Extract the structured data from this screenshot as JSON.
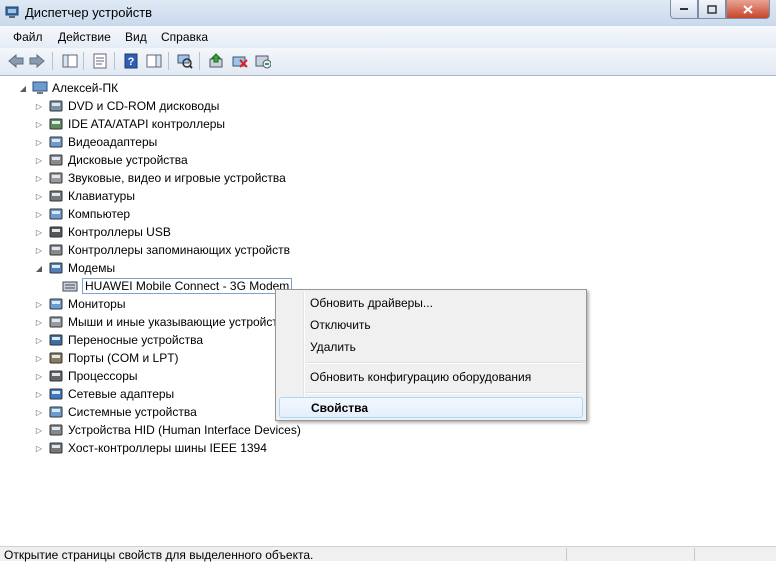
{
  "window": {
    "title": "Диспетчер устройств",
    "controls": [
      "minimize",
      "maximize",
      "close"
    ]
  },
  "menubar": {
    "items": [
      "Файл",
      "Действие",
      "Вид",
      "Справка"
    ]
  },
  "toolbar": {
    "icons": [
      "back-arrow-icon",
      "forward-arrow-icon",
      "show-hide-tree-icon",
      "properties-icon",
      "help-icon",
      "action-pane-icon",
      "scan-hardware-icon",
      "update-driver-icon",
      "disable-device-icon",
      "uninstall-device-icon"
    ]
  },
  "tree": {
    "root": "Алексей-ПК",
    "categories": [
      {
        "label": "DVD и CD-ROM дисководы",
        "expanded": false,
        "icon": "dvd-drive-icon"
      },
      {
        "label": "IDE ATA/ATAPI контроллеры",
        "expanded": false,
        "icon": "ide-controller-icon"
      },
      {
        "label": "Видеоадаптеры",
        "expanded": false,
        "icon": "display-adapter-icon"
      },
      {
        "label": "Дисковые устройства",
        "expanded": false,
        "icon": "disk-drive-icon"
      },
      {
        "label": "Звуковые, видео и игровые устройства",
        "expanded": false,
        "icon": "sound-device-icon"
      },
      {
        "label": "Клавиатуры",
        "expanded": false,
        "icon": "keyboard-icon"
      },
      {
        "label": "Компьютер",
        "expanded": false,
        "icon": "computer-icon"
      },
      {
        "label": "Контроллеры USB",
        "expanded": false,
        "icon": "usb-icon"
      },
      {
        "label": "Контроллеры запоминающих устройств",
        "expanded": false,
        "icon": "storage-controller-icon"
      },
      {
        "label": "Модемы",
        "expanded": true,
        "icon": "modem-icon"
      },
      {
        "label": "Мониторы",
        "expanded": false,
        "icon": "monitor-icon"
      },
      {
        "label": "Мыши и иные указывающие устройства",
        "expanded": false,
        "icon": "mouse-icon"
      },
      {
        "label": "Переносные устройства",
        "expanded": false,
        "icon": "portable-device-icon"
      },
      {
        "label": "Порты (COM и LPT)",
        "expanded": false,
        "icon": "port-icon"
      },
      {
        "label": "Процессоры",
        "expanded": false,
        "icon": "processor-icon"
      },
      {
        "label": "Сетевые адаптеры",
        "expanded": false,
        "icon": "network-adapter-icon"
      },
      {
        "label": "Системные устройства",
        "expanded": false,
        "icon": "system-device-icon"
      },
      {
        "label": "Устройства HID (Human Interface Devices)",
        "expanded": false,
        "icon": "hid-icon"
      },
      {
        "label": "Хост-контроллеры шины IEEE 1394",
        "expanded": false,
        "icon": "ieee1394-icon"
      }
    ],
    "modem_child": "HUAWEI Mobile Connect - 3G Modem"
  },
  "context_menu": {
    "items": [
      {
        "label": "Обновить драйверы..."
      },
      {
        "label": "Отключить"
      },
      {
        "label": "Удалить"
      },
      {
        "label": "Обновить конфигурацию оборудования"
      },
      {
        "label": "Свойства",
        "default": true,
        "highlighted": true
      }
    ]
  },
  "statusbar": {
    "text": "Открытие страницы свойств для выделенного объекта."
  },
  "colors": {
    "titlebar": "#c9d9ec",
    "selection_border": "#7da2ce",
    "menu_hover_border": "#a8d8f8",
    "close_button": "#c7452b"
  }
}
